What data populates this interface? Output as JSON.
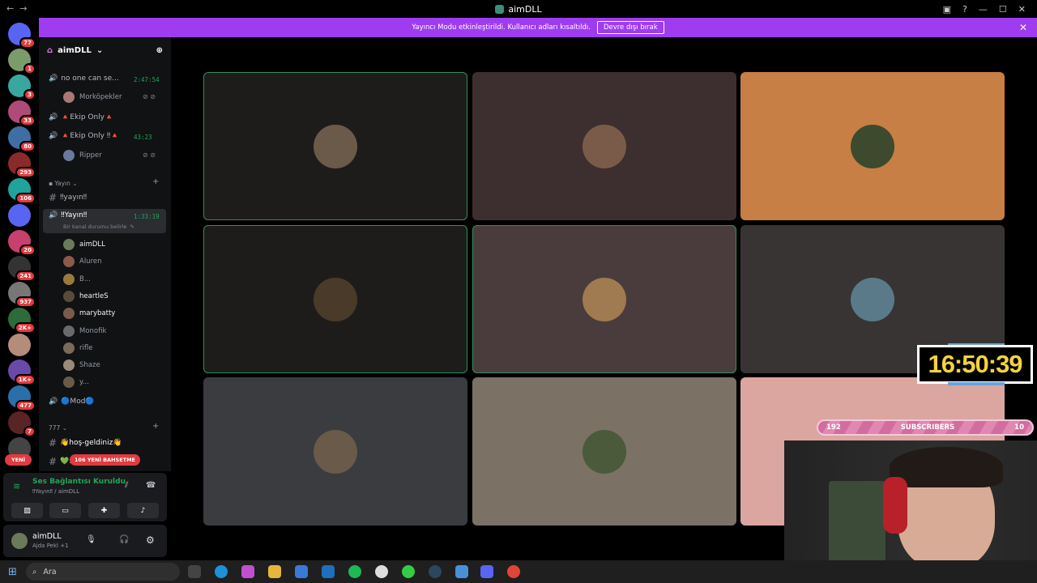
{
  "window": {
    "title": "aimDLL"
  },
  "notice": {
    "text": "Yayıncı Modu etkinleştirildi. Kullanıcı adları kısaltıldı.",
    "button": "Devre dışı bırak"
  },
  "servers": [
    {
      "badge": "77",
      "color": "#5865f2"
    },
    {
      "badge": "1",
      "color": "#7c9b6a"
    },
    {
      "badge": "3",
      "color": "#3aa6a0"
    },
    {
      "badge": "33",
      "color": "#b04a78"
    },
    {
      "badge": "80",
      "color": "#3e6ea3"
    },
    {
      "badge": "293",
      "color": "#8a2b2b"
    },
    {
      "badge": "106",
      "color": "#1fa39a"
    },
    {
      "badge": "",
      "color": "#5865f2"
    },
    {
      "badge": "20",
      "color": "#c8406d"
    },
    {
      "badge": "241",
      "color": "#333333"
    },
    {
      "badge": "937",
      "color": "#777777"
    },
    {
      "badge": "2K+",
      "color": "#2e6b3b"
    },
    {
      "badge": "",
      "color": "#b38c7a"
    },
    {
      "badge": "1K+",
      "color": "#6a4aa8"
    },
    {
      "badge": "477",
      "color": "#2a6fa8"
    },
    {
      "badge": "7",
      "color": "#5a2424"
    },
    {
      "badge": "",
      "color": "#444444"
    }
  ],
  "guild": {
    "name": "aimDLL"
  },
  "channels": [
    {
      "type": "voice",
      "name": "no one can se...",
      "time": "2:47:54"
    },
    {
      "type": "user",
      "name": "Morköpekler"
    },
    {
      "type": "voice",
      "name": "🔺Ekip Only🔺",
      "time": ""
    },
    {
      "type": "voice",
      "name": "🔺Ekip Only ‼🔺",
      "time": "43:23"
    },
    {
      "type": "user",
      "name": "Ripper"
    }
  ],
  "category_yayin": "Yayın",
  "text_yayin": "‼yayın‼",
  "voice_yayin": {
    "name": "‼Yayın‼",
    "time": "1:33:19",
    "status": "Bir kanal durumu belirle"
  },
  "yayin_users": [
    "aimDLL",
    "Aluren",
    "B...",
    "heartleS",
    "marybatty",
    "Monofik",
    "rifle",
    "Shaze",
    "y..."
  ],
  "mod_channel": "🔵Mod🔵",
  "category_777": "777",
  "text_hos": "👋hoş-geldiniz👋",
  "text_al": "💚...-al...",
  "badges": {
    "yeni": "YENİ",
    "mention": "106 YENİ BAHSETME"
  },
  "voice_panel": {
    "title": "Ses Bağlantısı Kuruldu",
    "sub": "‼Yayın‼ / aimDLL"
  },
  "user_panel": {
    "name": "aimDLL",
    "status": "Ajda Pekl +1"
  },
  "tiles": [
    {
      "bg": "#1e1c1b",
      "avatar": "#6b5a4a",
      "speaking": true
    },
    {
      "bg": "#3d2f2f",
      "avatar": "#7a5b4a",
      "speaking": false
    },
    {
      "bg": "#c77f45",
      "avatar": "#3d4a2d",
      "speaking": false
    },
    {
      "bg": "#1e1c1b",
      "avatar": "#4a3a2a",
      "speaking": true
    },
    {
      "bg": "#4a3c3c",
      "avatar": "#a07a50",
      "speaking": true
    },
    {
      "bg": "#383434",
      "avatar": "#5a7a8a",
      "speaking": false
    },
    {
      "bg": "#3a3c40",
      "avatar": "#6a5a4a",
      "speaking": false
    },
    {
      "bg": "#7b7164",
      "avatar": "#4a5a3a",
      "speaking": false
    },
    {
      "bg": "#dba6a0",
      "avatar": "#dba6a0",
      "speaking": false
    }
  ],
  "overlay": {
    "clock": "16:50:39",
    "subs_left": "192",
    "subs_label": "SUBSCRIBERS",
    "subs_right": "10"
  },
  "taskbar": {
    "search": "Ara"
  }
}
